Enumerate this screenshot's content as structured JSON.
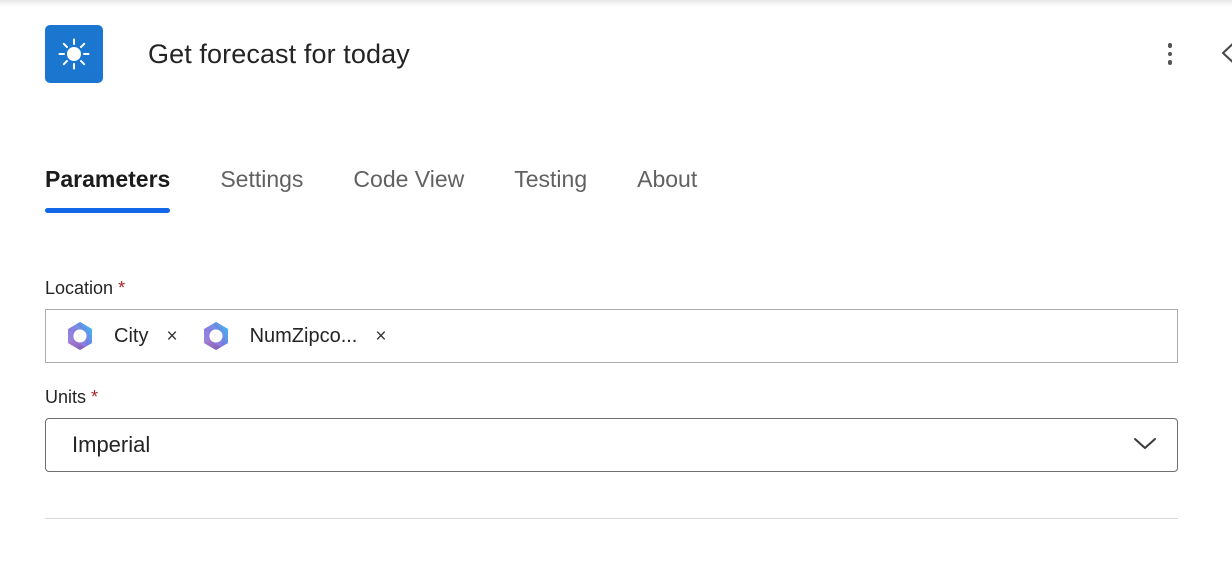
{
  "header": {
    "app_icon": "sun-icon",
    "app_icon_bg": "#1a76cf",
    "title": "Get forecast for today",
    "overflow_menu": "more-options",
    "collapse": "collapse-panel"
  },
  "tabs": [
    {
      "label": "Parameters",
      "active": true
    },
    {
      "label": "Settings",
      "active": false
    },
    {
      "label": "Code View",
      "active": false
    },
    {
      "label": "Testing",
      "active": false
    },
    {
      "label": "About",
      "active": false
    }
  ],
  "active_tab_color": "#1267e8",
  "required_color": "#a4262c",
  "form": {
    "location": {
      "label": "Location",
      "required_mark": "*",
      "tokens": [
        {
          "icon": "copilot-icon",
          "label": "City",
          "remove": "×"
        },
        {
          "icon": "copilot-icon",
          "label": "NumZipco...",
          "remove": "×"
        }
      ]
    },
    "units": {
      "label": "Units",
      "required_mark": "*",
      "value": "Imperial",
      "chevron": "chevron-down-icon"
    }
  }
}
